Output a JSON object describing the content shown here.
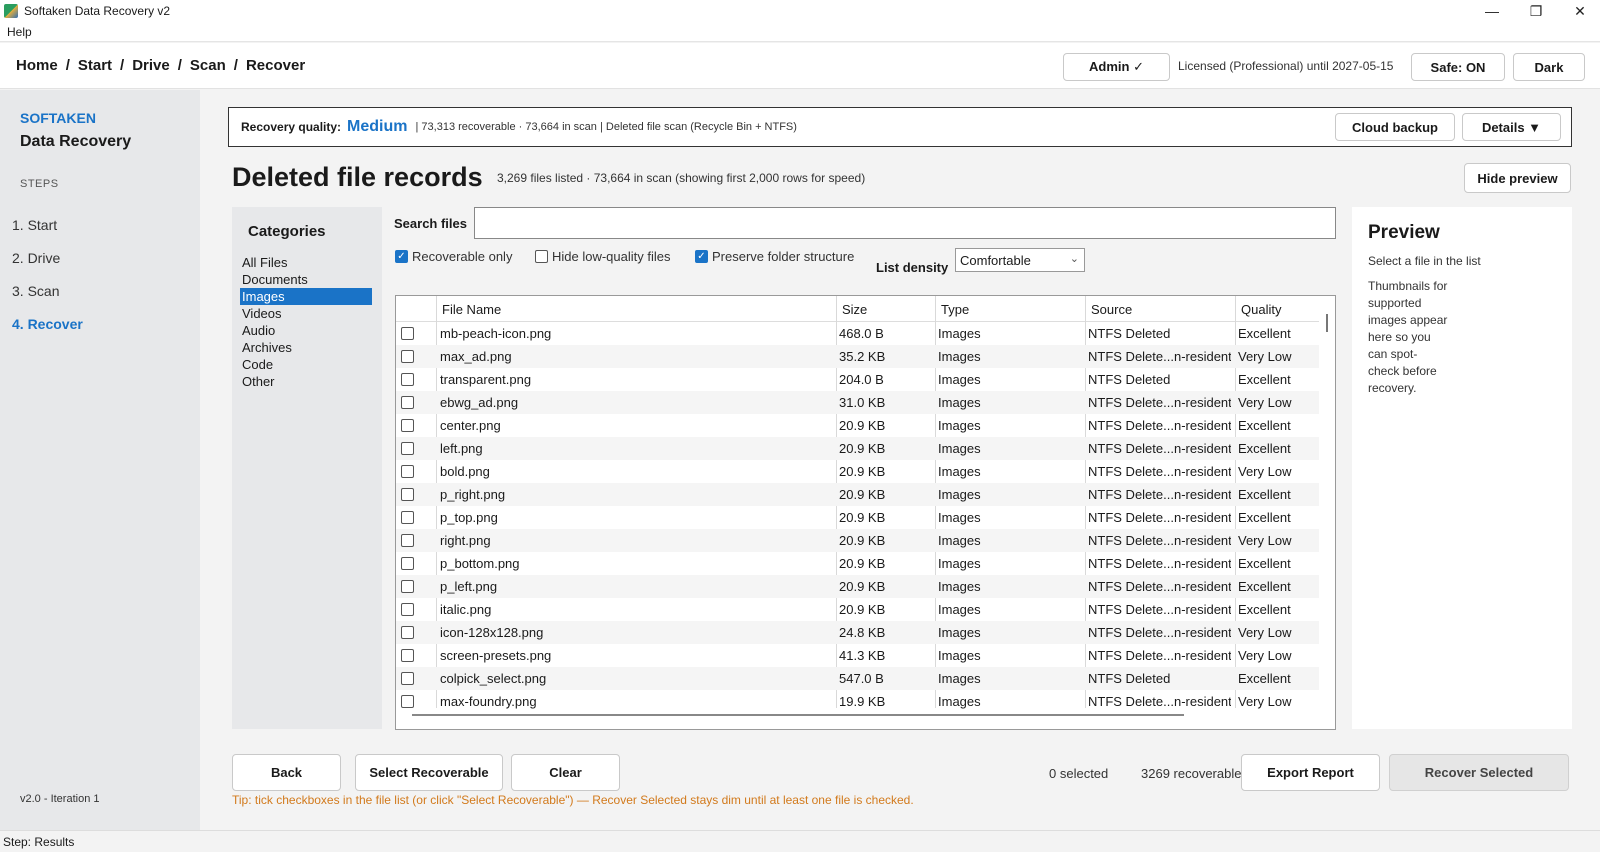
{
  "window": {
    "title": "Softaken Data Recovery v2",
    "menu_help": "Help",
    "minimize_glyph": "—",
    "maximize_glyph": "❐",
    "close_glyph": "✕"
  },
  "header": {
    "breadcrumb": [
      "Home",
      "Start",
      "Drive",
      "Scan",
      "Recover"
    ],
    "separator": "/",
    "admin_label": "Admin ✓",
    "license_text": "Licensed (Professional) until 2027-05-15",
    "safe_label": "Safe: ON",
    "theme_label": "Dark"
  },
  "sidebar": {
    "brand_line1": "SOFTAKEN",
    "brand_line2": "Data Recovery",
    "steps_heading": "STEPS",
    "steps": [
      "1. Start",
      "2. Drive",
      "3. Scan",
      "4. Recover"
    ],
    "active_step": 3,
    "version": "v2.0  -  Iteration 1"
  },
  "quality_bar": {
    "label": "Recovery quality:",
    "quality": "Medium",
    "counts": "|  73,313 recoverable · 73,664 in scan  |  Deleted file scan (Recycle Bin + NTFS)",
    "cloud_backup_label": "Cloud backup",
    "details_label": "Details ▼"
  },
  "main": {
    "title": "Deleted file records",
    "subtitle": "3,269 files listed · 73,664 in scan  (showing first 2,000 rows for speed)",
    "hide_preview_label": "Hide preview"
  },
  "categories": {
    "heading": "Categories",
    "items": [
      "All Files",
      "Documents",
      "Images",
      "Videos",
      "Audio",
      "Archives",
      "Code",
      "Other"
    ],
    "selected": "Images"
  },
  "search": {
    "label": "Search files",
    "value": "",
    "placeholder": ""
  },
  "options": {
    "recoverable_only": {
      "label": "Recoverable only",
      "checked": true
    },
    "hide_low_quality": {
      "label": "Hide low-quality files",
      "checked": false
    },
    "preserve_folders": {
      "label": "Preserve folder structure",
      "checked": true
    },
    "density_label": "List density",
    "density_value": "Comfortable"
  },
  "table": {
    "columns": [
      "File Name",
      "Size",
      "Type",
      "Source",
      "Quality"
    ],
    "rows": [
      [
        "mb-peach-icon.png",
        "468.0 B",
        "Images",
        "NTFS Deleted",
        "Excellent"
      ],
      [
        "max_ad.png",
        "35.2 KB",
        "Images",
        "NTFS Delete...n-resident)",
        "Very Low"
      ],
      [
        "transparent.png",
        "204.0 B",
        "Images",
        "NTFS Deleted",
        "Excellent"
      ],
      [
        "ebwg_ad.png",
        "31.0 KB",
        "Images",
        "NTFS Delete...n-resident)",
        "Very Low"
      ],
      [
        "center.png",
        "20.9 KB",
        "Images",
        "NTFS Delete...n-resident)",
        "Excellent"
      ],
      [
        "left.png",
        "20.9 KB",
        "Images",
        "NTFS Delete...n-resident)",
        "Excellent"
      ],
      [
        "bold.png",
        "20.9 KB",
        "Images",
        "NTFS Delete...n-resident)",
        "Very Low"
      ],
      [
        "p_right.png",
        "20.9 KB",
        "Images",
        "NTFS Delete...n-resident)",
        "Excellent"
      ],
      [
        "p_top.png",
        "20.9 KB",
        "Images",
        "NTFS Delete...n-resident)",
        "Excellent"
      ],
      [
        "right.png",
        "20.9 KB",
        "Images",
        "NTFS Delete...n-resident)",
        "Very Low"
      ],
      [
        "p_bottom.png",
        "20.9 KB",
        "Images",
        "NTFS Delete...n-resident)",
        "Excellent"
      ],
      [
        "p_left.png",
        "20.9 KB",
        "Images",
        "NTFS Delete...n-resident)",
        "Excellent"
      ],
      [
        "italic.png",
        "20.9 KB",
        "Images",
        "NTFS Delete...n-resident)",
        "Excellent"
      ],
      [
        "icon-128x128.png",
        "24.8 KB",
        "Images",
        "NTFS Delete...n-resident)",
        "Very Low"
      ],
      [
        "screen-presets.png",
        "41.3 KB",
        "Images",
        "NTFS Delete...n-resident)",
        "Very Low"
      ],
      [
        "colpick_select.png",
        "547.0 B",
        "Images",
        "NTFS Deleted",
        "Excellent"
      ],
      [
        "max-foundry.png",
        "19.9 KB",
        "Images",
        "NTFS Delete...n-resident)",
        "Very Low"
      ]
    ]
  },
  "preview": {
    "heading": "Preview",
    "hint": "Select a file in the list",
    "body": "Thumbnails for supported images appear here so you can spot-check before recovery."
  },
  "footer": {
    "back_label": "Back",
    "select_recoverable_label": "Select Recoverable",
    "clear_label": "Clear",
    "selected_count": "0 selected",
    "recoverable_count": "3269 recoverable",
    "export_label": "Export Report",
    "recover_label": "Recover Selected",
    "tip": "Tip: tick checkboxes in the file list (or click \"Select Recoverable\") — Recover Selected stays dim until at least one file is checked."
  },
  "status_bar": {
    "text": "Step: Results"
  },
  "colors": {
    "accent": "#1a73c7",
    "tip": "#d27a1c",
    "sidebar_bg": "#e7e8ea"
  }
}
